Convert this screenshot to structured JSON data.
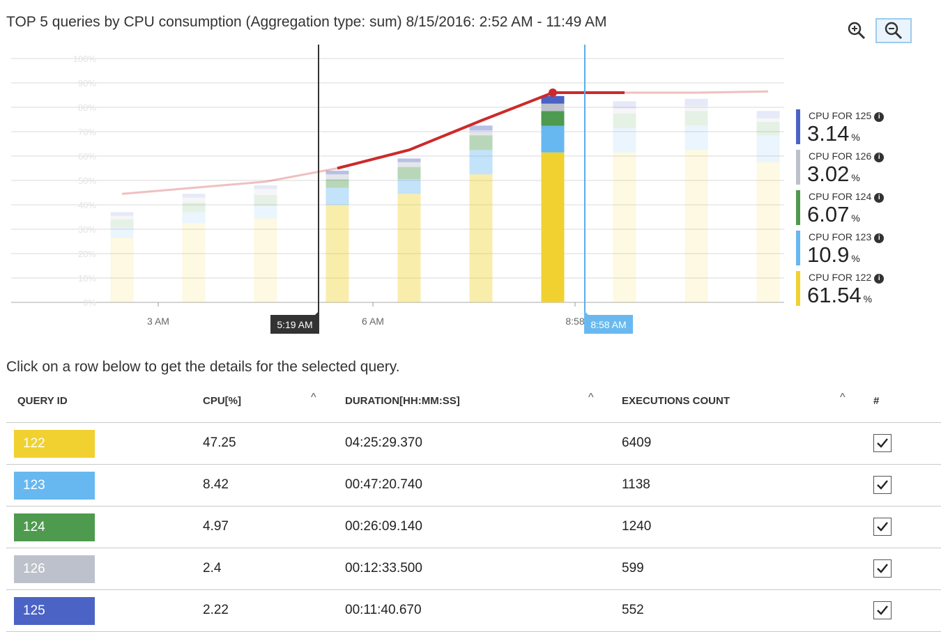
{
  "title": "TOP 5 queries by CPU consumption (Aggregation type: sum) 8/15/2016: 2:52 AM - 11:49 AM",
  "toolbar": {
    "zoom_in_icon": "zoom-in-icon",
    "zoom_out_icon": "zoom-out-icon"
  },
  "chart_data": {
    "type": "bar",
    "stacked": true,
    "ylim": [
      0,
      100
    ],
    "y_ticks": [
      "100%",
      "90%",
      "80%",
      "70%",
      "60%",
      "50%",
      "40%",
      "30%",
      "20%",
      "10%",
      "0%"
    ],
    "x_ticks": [
      "3 AM",
      "6 AM",
      "8:58"
    ],
    "grid": true,
    "selection": {
      "start_label": "5:19 AM",
      "end_label": "8:58 AM"
    },
    "series": [
      {
        "name": "122",
        "color": "#f0d130",
        "values": [
          26.5,
          32.5,
          34.5,
          40,
          44.5,
          52.5,
          61.5,
          61.5,
          62.5,
          57.5
        ]
      },
      {
        "name": "123",
        "color": "#67b8f0",
        "values": [
          4,
          4.5,
          5,
          7,
          6,
          10,
          10.9,
          10,
          10,
          11
        ]
      },
      {
        "name": "124",
        "color": "#4e9a4f",
        "values": [
          3.5,
          4,
          4.5,
          3.5,
          5,
          6,
          6.07,
          6,
          6,
          5.5
        ]
      },
      {
        "name": "126",
        "color": "#bcc1cb",
        "values": [
          1.5,
          2,
          2.5,
          2,
          2,
          2,
          3.02,
          2,
          2,
          1.5
        ]
      },
      {
        "name": "125",
        "color": "#4b63c4",
        "values": [
          1.5,
          1.5,
          1.5,
          1.5,
          1.5,
          2,
          3.14,
          3,
          3,
          3
        ]
      }
    ],
    "total_line": {
      "color": "#cc2a2a",
      "values": [
        44.5,
        47,
        49.5,
        55,
        62.5,
        74.5,
        86,
        86,
        86,
        86.5
      ],
      "marker_index": 6
    }
  },
  "legend": [
    {
      "label": "CPU FOR 125",
      "value": "3.14",
      "unit": "%",
      "color": "#4b63c4"
    },
    {
      "label": "CPU FOR 126",
      "value": "3.02",
      "unit": "%",
      "color": "#bcc1cb"
    },
    {
      "label": "CPU FOR 124",
      "value": "6.07",
      "unit": "%",
      "color": "#4e9a4f"
    },
    {
      "label": "CPU FOR 123",
      "value": "10.9",
      "unit": "%",
      "color": "#67b8f0"
    },
    {
      "label": "CPU FOR 122",
      "value": "61.54",
      "unit": "%",
      "color": "#f0d130"
    }
  ],
  "hint": "Click on a row below to get the details for the selected query.",
  "table": {
    "columns": [
      "QUERY ID",
      "CPU[%]",
      "DURATION[HH:MM:SS]",
      "EXECUTIONS COUNT",
      "#"
    ],
    "sort_icon": "^",
    "rows": [
      {
        "id": "122",
        "color": "#f0d130",
        "cpu": "47.25",
        "duration": "04:25:29.370",
        "executions": "6409",
        "checked": true
      },
      {
        "id": "123",
        "color": "#67b8f0",
        "cpu": "8.42",
        "duration": "00:47:20.740",
        "executions": "1138",
        "checked": true
      },
      {
        "id": "124",
        "color": "#4e9a4f",
        "cpu": "4.97",
        "duration": "00:26:09.140",
        "executions": "1240",
        "checked": true
      },
      {
        "id": "126",
        "color": "#bcc1cb",
        "cpu": "2.4",
        "duration": "00:12:33.500",
        "executions": "599",
        "checked": true
      },
      {
        "id": "125",
        "color": "#4b63c4",
        "cpu": "2.22",
        "duration": "00:11:40.670",
        "executions": "552",
        "checked": true
      }
    ]
  }
}
